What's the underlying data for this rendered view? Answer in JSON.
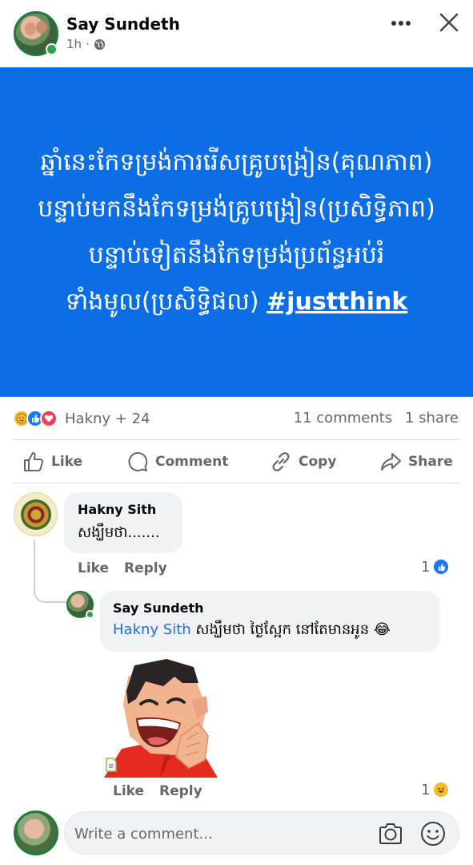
{
  "post": {
    "author": "Say Sundeth",
    "time": "1h",
    "dot": "·",
    "background_color": "#0b6ee6",
    "text_lines": [
      "ឆ្នាំនេះកែទម្រង់ការរើសគ្រូបង្រៀន(គុណភាព)",
      "បន្ទាប់មកនឹងកែទម្រង់គ្រូបង្រៀន(ប្រសិទ្ធិភាព)",
      "បន្ទាប់ទៀតនឹងកែទម្រង់ប្រព័ន្ធអប់រំ",
      "ទាំងមូល(ប្រសិទ្ធិផល)"
    ],
    "hashtag": "#justthink"
  },
  "reactions": {
    "names": "Hakny + 24",
    "comments": "11 comments",
    "shares": "1 share",
    "icons": [
      "care-icon",
      "like-icon",
      "love-icon"
    ]
  },
  "actions": {
    "like": "Like",
    "comment": "Comment",
    "copy": "Copy",
    "share": "Share"
  },
  "comments": [
    {
      "name": "Hakny Sith",
      "text": "សង្ឃឹមថា.......",
      "like": "Like",
      "reply": "Reply",
      "reaction_count": "1",
      "reaction_icon": "like-icon"
    },
    {
      "name": "Say Sundeth",
      "mention": "Hakny Sith",
      "text": " សង្ឃឹមថា ថ្ងៃស្អែក នៅតែមានអូន 😂",
      "sticker": "laughing-man-sticker",
      "like": "Like",
      "reply": "Reply",
      "reaction_count": "1",
      "reaction_icon": "haha-icon"
    }
  ],
  "composer": {
    "placeholder": "Write a comment..."
  },
  "colors": {
    "accent": "#1877f2",
    "online": "#31a24c",
    "mention": "#216fdb",
    "muted": "#65676b"
  }
}
